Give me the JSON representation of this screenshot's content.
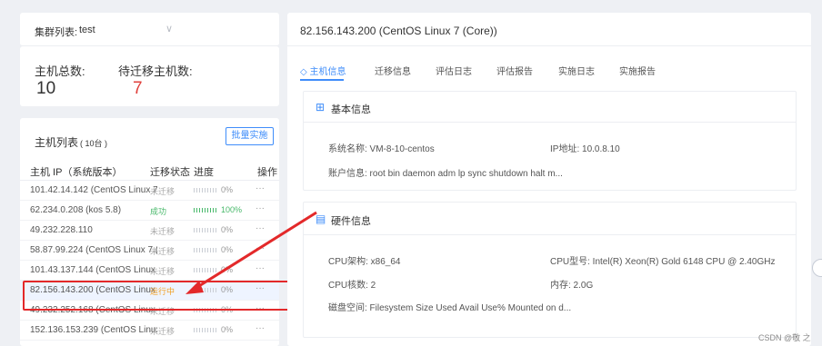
{
  "cluster": {
    "label": "集群列表:",
    "value": "test",
    "chevron": "∨"
  },
  "stats": {
    "total_label": "主机总数:",
    "total_value": "10",
    "pending_label": "待迁移主机数:",
    "pending_value": "7",
    "pending_color": "#e0413c"
  },
  "host_list": {
    "title": "主机列表",
    "count": "( 10台 )",
    "batch_button": "批量实施",
    "columns": {
      "name": "主机 IP（系统版本）",
      "status": "迁移状态",
      "progress": "进度",
      "action": "操作"
    },
    "rows": [
      {
        "name": "101.42.14.142 (CentOS Linux 7 (C...",
        "status": "未迁移",
        "progress": "0%",
        "action": "···"
      },
      {
        "name": "62.234.0.208 (kos 5.8)",
        "status": "成功",
        "progress": "100%",
        "action": "···"
      },
      {
        "name": "49.232.228.110",
        "status": "未迁移",
        "progress": "0%",
        "action": "···"
      },
      {
        "name": "58.87.99.224 (CentOS Linux 7 (Co...",
        "status": "未迁移",
        "progress": "0%",
        "action": "···"
      },
      {
        "name": "101.43.137.144 (CentOS Linux 7 (...",
        "status": "未迁移",
        "progress": "0%",
        "action": "···"
      },
      {
        "name": "82.156.143.200 (CentOS Linux 7 (...",
        "status": "运行中",
        "progress": "0%",
        "action": "···"
      },
      {
        "name": "49.232.252.168 (CentOS Linux 7 (...",
        "status": "未迁移",
        "progress": "0%",
        "action": "···"
      },
      {
        "name": "152.136.153.239 (CentOS Linux 7 ...",
        "status": "未迁移",
        "progress": "0%",
        "action": "···"
      }
    ]
  },
  "detail": {
    "title": "82.156.143.200 (CentOS Linux 7 (Core))",
    "tabs": [
      "主机信息",
      "迁移信息",
      "评估日志",
      "评估报告",
      "实施日志",
      "实施报告"
    ],
    "active_tab_icon": "◇",
    "basic": {
      "title": "基本信息",
      "icon": "⊞",
      "system_name": "系统名称: VM-8-10-centos",
      "ip": "IP地址: 10.0.8.10",
      "accounts": "账户信息: root bin daemon adm lp sync shutdown halt m..."
    },
    "hardware": {
      "title": "硬件信息",
      "icon": "▤",
      "cpu_arch": "CPU架构: x86_64",
      "cpu_model": "CPU型号:  Intel(R) Xeon(R) Gold 6148 CPU @ 2.40GHz",
      "cpu_cores": "CPU核数: 2",
      "memory": "内存: 2.0G",
      "disk": "磁盘空间: Filesystem Size Used Avail Use% Mounted on d..."
    }
  },
  "watermark": "CSDN @敬 之",
  "colors": {
    "accent": "#3f8dfa",
    "success": "#47b86a",
    "running": "#f2a024",
    "annotation": "#e3292a"
  }
}
